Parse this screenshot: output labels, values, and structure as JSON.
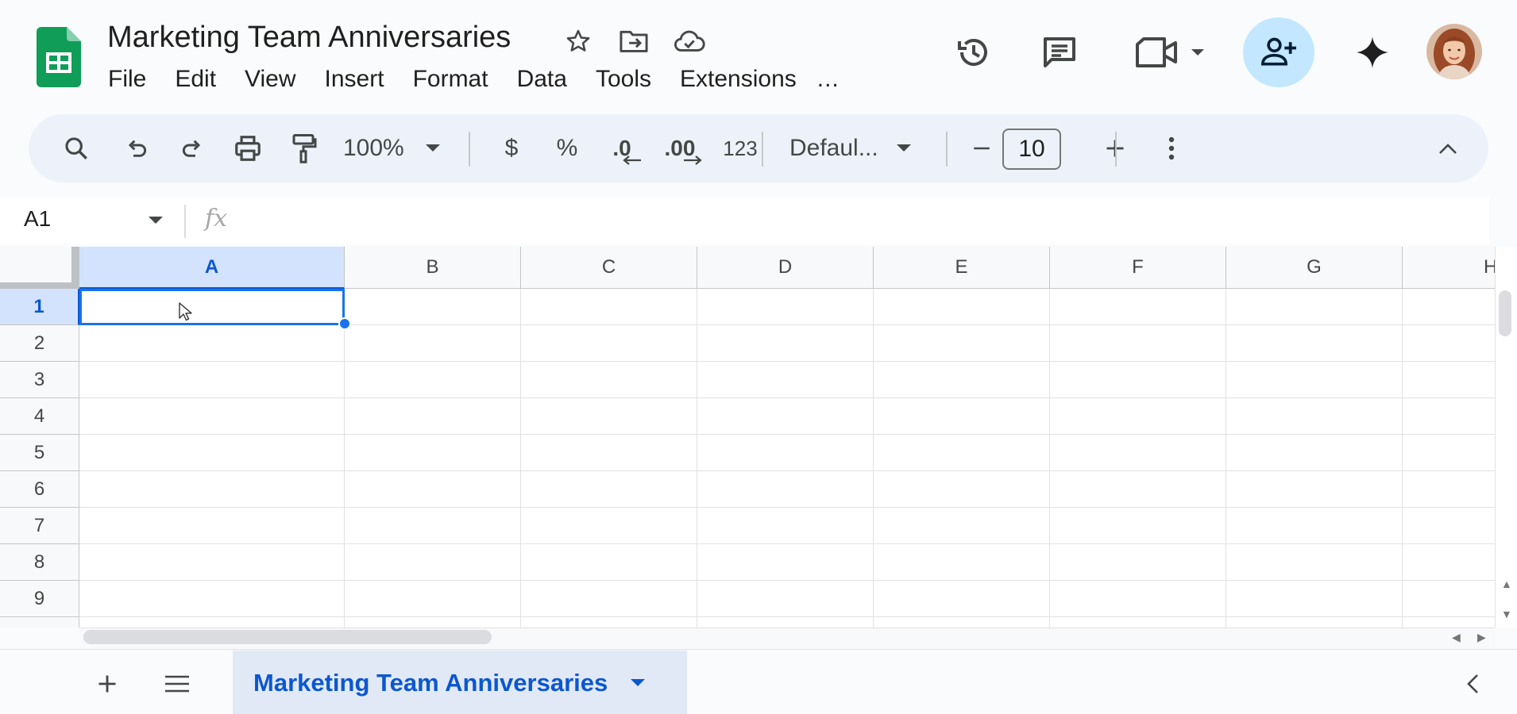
{
  "document": {
    "title": "Marketing Team Anniversaries"
  },
  "menu": {
    "items": [
      "File",
      "Edit",
      "View",
      "Insert",
      "Format",
      "Data",
      "Tools",
      "Extensions"
    ],
    "more": "..."
  },
  "toolbar": {
    "zoom": "100%",
    "currency": "$",
    "percent": "%",
    "decrease_decimal": ".0",
    "increase_decimal": ".00",
    "number_format": "123",
    "font": "Defaul...",
    "font_size": "10"
  },
  "formula_bar": {
    "name_box": "A1",
    "fx": "fx",
    "content": ""
  },
  "grid": {
    "columns": [
      "A",
      "B",
      "C",
      "D",
      "E",
      "F",
      "G",
      "H"
    ],
    "rows": [
      "1",
      "2",
      "3",
      "4",
      "5",
      "6",
      "7",
      "8",
      "9"
    ],
    "active_cell": "A1"
  },
  "sheets": {
    "active_tab": "Marketing Team Anniversaries"
  },
  "colors": {
    "accent": "#0b57d0",
    "selection_bg": "#d3e3fd",
    "share_button_bg": "#c2e7ff",
    "sheets_green": "#0f9d58",
    "toolbar_bg": "#edf2fa"
  },
  "icons": {
    "title": [
      "star-icon",
      "move-folder-icon",
      "cloud-saved-icon"
    ],
    "header_right": [
      "history-icon",
      "comments-icon",
      "meet-video-icon",
      "share-person-add-icon",
      "gemini-sparkle-icon"
    ],
    "toolbar": [
      "search-icon",
      "undo-icon",
      "redo-icon",
      "print-icon",
      "paint-format-icon",
      "more-vert-icon",
      "collapse-chevron-icon"
    ],
    "sheetbar": [
      "add-sheet-icon",
      "all-sheets-icon",
      "explore-chevron-icon"
    ]
  }
}
